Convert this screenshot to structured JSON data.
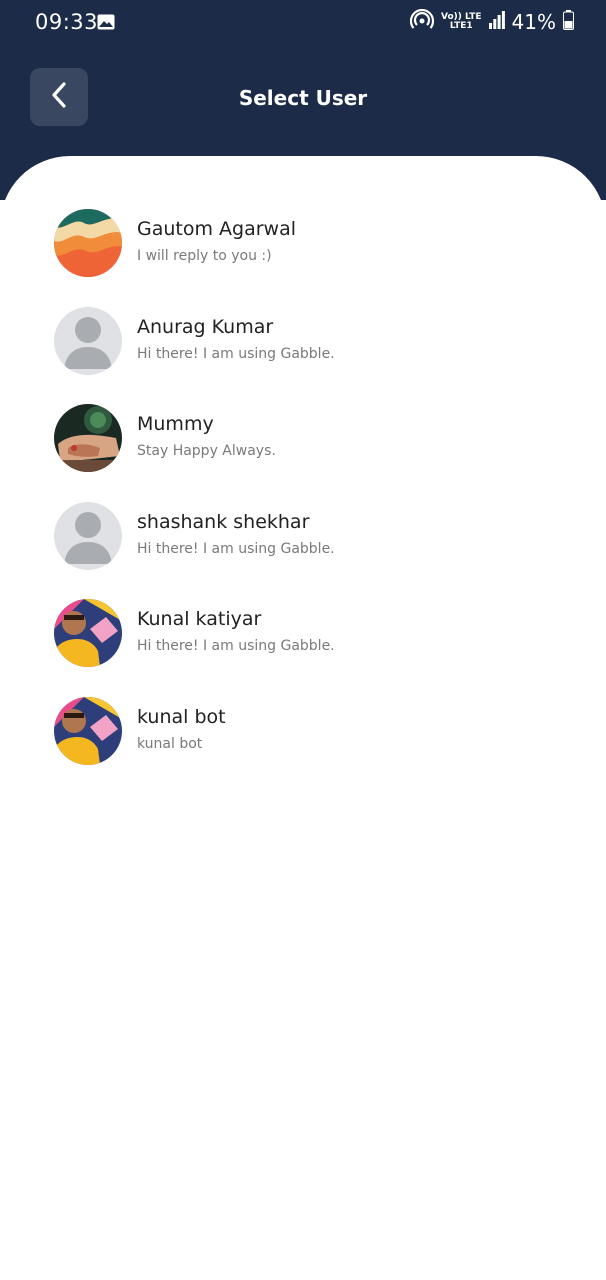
{
  "status_bar": {
    "time": "09:33",
    "net_top": "Vo)) LTE",
    "net_bottom": "LTE1",
    "battery": "41%"
  },
  "header": {
    "title": "Select User"
  },
  "users": [
    {
      "name": "Gautom Agarwal",
      "status": "I will reply to you :)",
      "avatar": "waves-art"
    },
    {
      "name": "Anurag Kumar",
      "status": "Hi there! I am using Gabble.",
      "avatar": "default-person"
    },
    {
      "name": "Mummy",
      "status": "Stay Happy Always.",
      "avatar": "hands-photo"
    },
    {
      "name": "shashank shekhar",
      "status": "Hi there! I am using Gabble.",
      "avatar": "default-person"
    },
    {
      "name": "Kunal katiyar",
      "status": "Hi there! I am using Gabble.",
      "avatar": "man-photo"
    },
    {
      "name": "kunal bot",
      "status": "kunal bot",
      "avatar": "man-photo"
    }
  ],
  "colors": {
    "header_bg": "#1c2b47",
    "back_button_bg": "#3a4760"
  }
}
